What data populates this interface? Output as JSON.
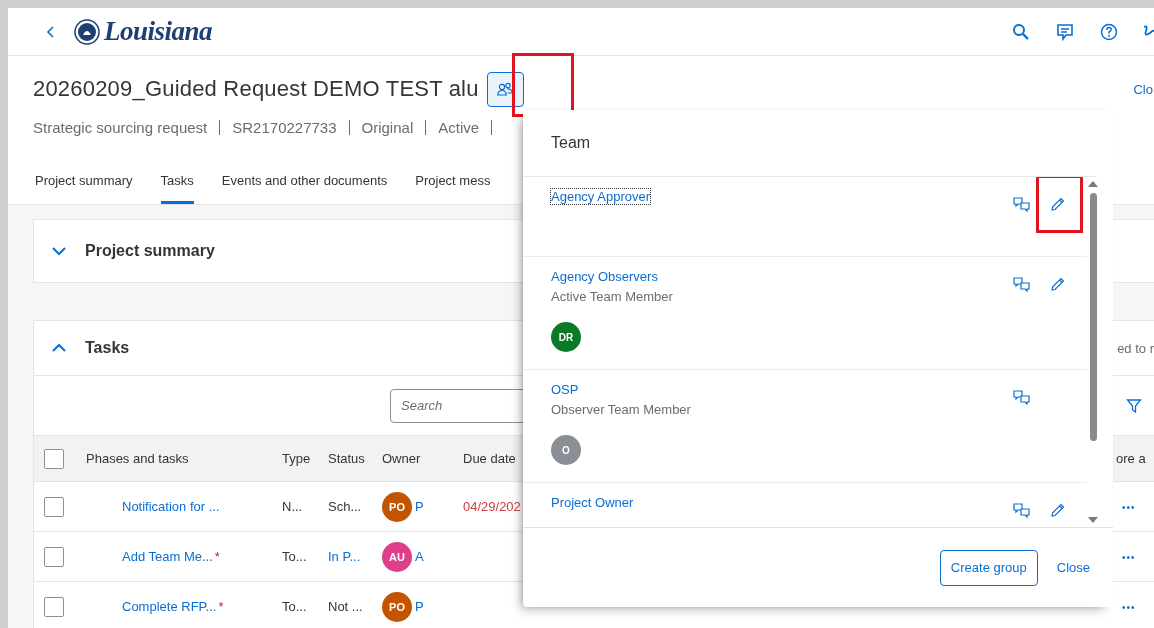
{
  "header": {
    "logo_text": "Louisiana"
  },
  "project": {
    "title": "20260209_Guided Request DEMO TEST alu",
    "meta": [
      "Strategic sourcing request",
      "SR2170227733",
      "Original",
      "Active"
    ],
    "close_link": "Clo"
  },
  "tabs": [
    {
      "label": "Project summary",
      "selected": false
    },
    {
      "label": "Tasks",
      "selected": true
    },
    {
      "label": "Events and other documents",
      "selected": false
    },
    {
      "label": "Project mess",
      "selected": false
    }
  ],
  "summary_section": {
    "title": "Project summary",
    "expanded": false
  },
  "tasks_section": {
    "title": "Tasks",
    "expanded": true,
    "side_text": "ed to r",
    "search": {
      "placeholder": "Search"
    },
    "select_all_checked": false,
    "columns": [
      "Phases and tasks",
      "Type",
      "Status",
      "Owner",
      "Due date",
      "ore a"
    ],
    "rows": [
      {
        "checked": false,
        "name": "Notification for ...",
        "type": "N...",
        "status": "Sch...",
        "status_link": false,
        "owner": {
          "initials": "PO",
          "color": "#c35500",
          "name": "P"
        },
        "due_date": {
          "text": "04/29/202",
          "overdue": true
        },
        "more": "•••"
      },
      {
        "checked": false,
        "name": "Add Team Me...",
        "required_mark": "*",
        "type": "To...",
        "status": "In P...",
        "status_link": true,
        "owner": {
          "initials": "AU",
          "color": "#df3f8a",
          "name": "A"
        },
        "more": "•••"
      },
      {
        "checked": false,
        "name": "Complete RFP...",
        "required_mark": "*",
        "type": "To...",
        "status": "Not ...",
        "status_link": false,
        "owner": {
          "initials": "PO",
          "color": "#c35500",
          "name": "P"
        },
        "more": "•••"
      }
    ]
  },
  "team_popover": {
    "title": "Team",
    "groups": [
      {
        "name": "Agency Approver",
        "focused": true,
        "editable": true,
        "highlighted_edit": true
      },
      {
        "name": "Agency Observers",
        "role": "Active Team Member",
        "focused": false,
        "editable": true,
        "highlighted_edit": false,
        "members": [
          {
            "initials": "DR",
            "color": "#0a7a26"
          }
        ]
      },
      {
        "name": "OSP",
        "role": "Observer Team Member",
        "focused": false,
        "editable": false,
        "highlighted_edit": false,
        "members": [
          {
            "initials": "O",
            "color": "#8a8f96"
          }
        ]
      },
      {
        "name": "Project Owner",
        "focused": false,
        "editable": true,
        "highlighted_edit": false
      }
    ],
    "buttons": [
      {
        "label": "Create group",
        "kind": "outlined"
      },
      {
        "label": "Close",
        "kind": "transparent"
      }
    ]
  },
  "team_button_highlighted": true
}
